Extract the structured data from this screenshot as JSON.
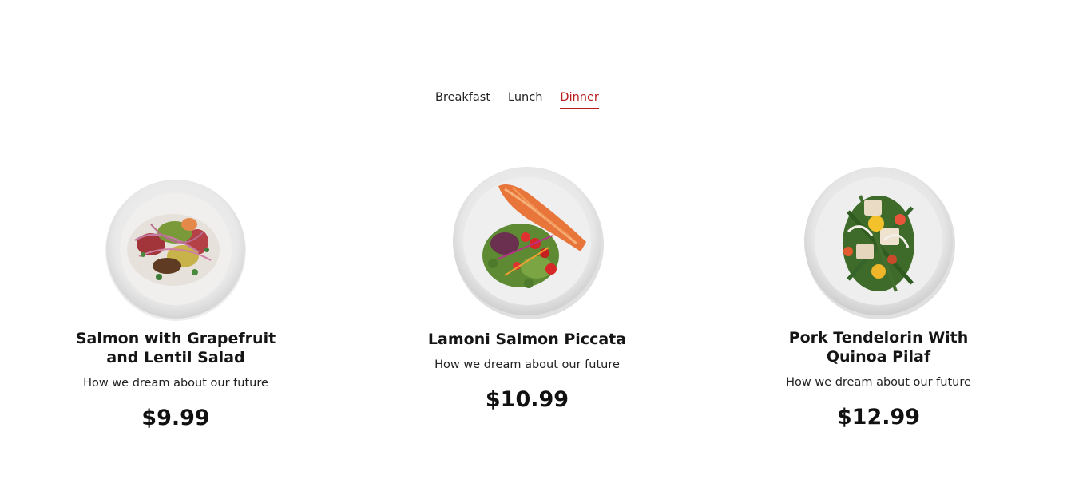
{
  "tabs": [
    {
      "label": "Breakfast",
      "active": false
    },
    {
      "label": "Lunch",
      "active": false
    },
    {
      "label": "Dinner",
      "active": true
    }
  ],
  "accent_color": "#b71c1c",
  "menu_items": [
    {
      "title": "Salmon with Grapefruit and Lentil Salad",
      "subtitle": "How we dream about our future",
      "price": "$9.99",
      "image_icon": "salad-plate-image"
    },
    {
      "title": "Lamoni Salmon Piccata",
      "subtitle": "How we dream about our future",
      "price": "$10.99",
      "image_icon": "salmon-plate-image"
    },
    {
      "title": "Pork Tendelorin With Quinoa Pilaf",
      "subtitle": "How we dream about our future",
      "price": "$12.99",
      "image_icon": "pork-plate-image"
    }
  ]
}
